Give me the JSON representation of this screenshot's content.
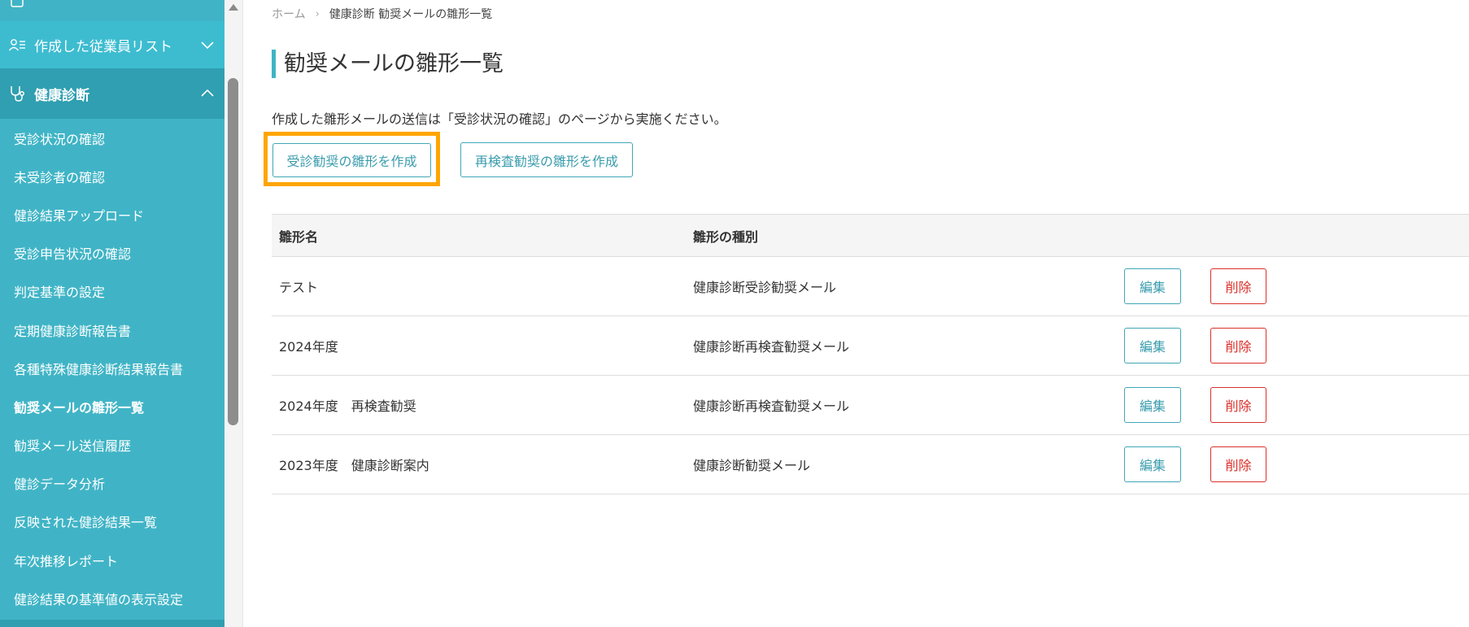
{
  "sidebar": {
    "partial_item": {
      "icon": "clipboard-icon"
    },
    "employee_list": {
      "label": "作成した従業員リスト",
      "icon": "person-list-icon",
      "chevron": "chevron-down-icon"
    },
    "health_checkup": {
      "label": "健康診断",
      "icon": "stethoscope-icon",
      "chevron": "chevron-up-icon"
    },
    "sub_items": [
      {
        "label": "受診状況の確認"
      },
      {
        "label": "未受診者の確認"
      },
      {
        "label": "健診結果アップロード"
      },
      {
        "label": "受診申告状況の確認"
      },
      {
        "label": "判定基準の設定"
      },
      {
        "label": "定期健康診断報告書"
      },
      {
        "label": "各種特殊健康診断結果報告書"
      },
      {
        "label": "勧奨メールの雛形一覧"
      },
      {
        "label": "勧奨メール送信履歴"
      },
      {
        "label": "健診データ分析"
      },
      {
        "label": "反映された健診結果一覧"
      },
      {
        "label": "年次推移レポート"
      },
      {
        "label": "健診結果の基準値の表示設定"
      }
    ],
    "active_index": 7,
    "colors": {
      "background": "#40b4c6",
      "active_section": "#2f9fb1"
    }
  },
  "breadcrumb": {
    "home": "ホーム",
    "separator": "›",
    "current": "健康診断 勧奨メールの雛形一覧"
  },
  "page": {
    "title": "勧奨メールの雛形一覧",
    "description": "作成した雛形メールの送信は「受診状況の確認」のページから実施ください。",
    "create_recommend_button": "受診勧奨の雛形を作成",
    "create_recheck_button": "再検査勧奨の雛形を作成",
    "highlight_color": "#ffa500",
    "accent_color": "#40b4c6"
  },
  "table": {
    "headers": {
      "name": "雛形名",
      "type": "雛形の種別"
    },
    "rows": [
      {
        "name": "テスト",
        "type": "健康診断受診勧奨メール",
        "edit": "編集",
        "delete": "削除"
      },
      {
        "name": "2024年度",
        "type": "健康診断再検査勧奨メール",
        "edit": "編集",
        "delete": "削除"
      },
      {
        "name": "2024年度　再検査勧奨",
        "type": "健康診断再検査勧奨メール",
        "edit": "編集",
        "delete": "削除"
      },
      {
        "name": "2023年度　健康診断案内",
        "type": "健康診断勧奨メール",
        "edit": "編集",
        "delete": "削除"
      }
    ]
  }
}
